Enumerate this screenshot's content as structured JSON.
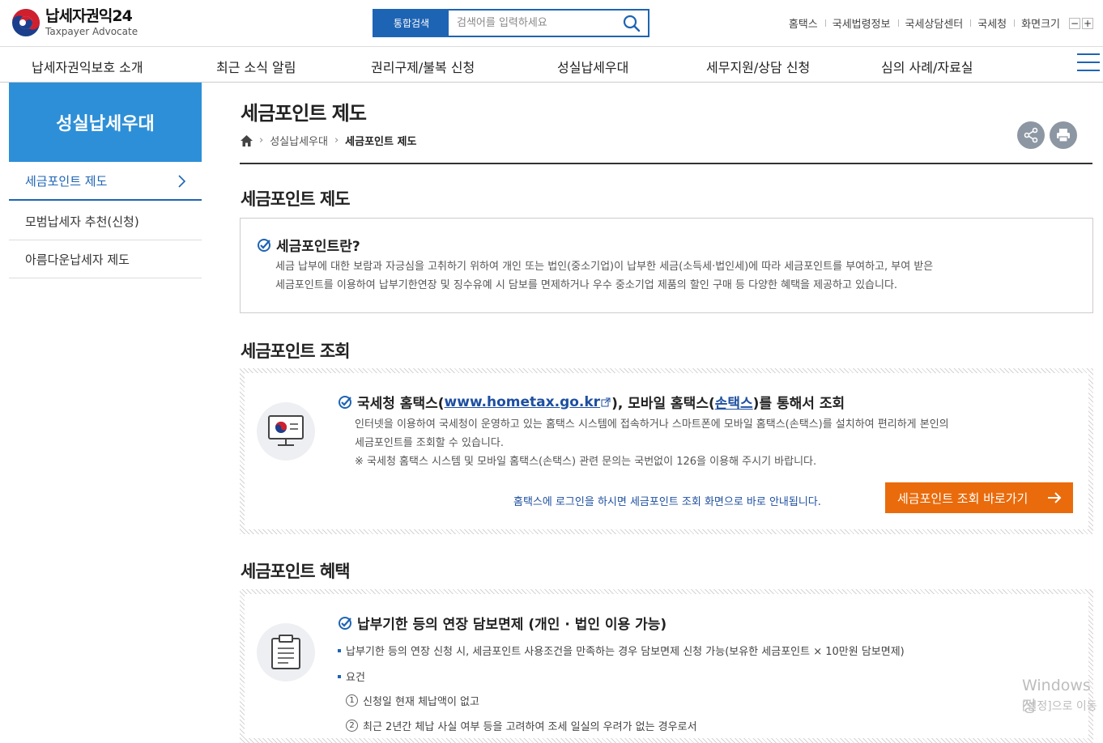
{
  "header": {
    "logo_title": "납세자권익24",
    "logo_sub": "Taxpayer Advocate",
    "search_tab": "통합검색",
    "search_placeholder": "검색어를 입력하세요",
    "util_links": [
      "홈택스",
      "국세법령정보",
      "국세상담센터",
      "국세청",
      "화면크기"
    ],
    "zoom_out": "−",
    "zoom_in": "+"
  },
  "gnb": [
    "납세자권익보호 소개",
    "최근 소식 알림",
    "권리구제/불복 신청",
    "성실납세우대",
    "세무지원/상담 신청",
    "심의 사례/자료실"
  ],
  "lnb": {
    "title": "성실납세우대",
    "items": [
      "세금포인트 제도",
      "모범납세자 추천(신청)",
      "아름다운납세자 제도"
    ]
  },
  "page": {
    "title": "세금포인트 제도",
    "breadcrumb": [
      "성실납세우대",
      "세금포인트 제도"
    ]
  },
  "section1": {
    "title": "세금포인트 제도",
    "heading": "세금포인트란?",
    "line1": "세금 납부에 대한 보람과 자긍심을 고취하기 위하여 개인 또는 법인(중소기업)이 납부한 세금(소득세·법인세)에 따라 세금포인트를 부여하고, 부여 받은",
    "line2": "세금포인트를 이용하여 납부기한연장 및 징수유예 시 담보를 면제하거나 우수 중소기업 제품의 할인 구매 등 다양한 혜택을 제공하고 있습니다."
  },
  "section2": {
    "title": "세금포인트 조회",
    "heading_pre": "국세청 홈택스(",
    "heading_link": "www.hometax.go.kr",
    "heading_post": "), 모바일 홈택스(",
    "heading_link2": "손택스",
    "heading_end": ")를 통해서 조회",
    "line1": "인터넷을 이용하여 국세청이 운영하고 있는 홈택스 시스템에 접속하거나 스마트폰에 모바일 홈택스(손택스)를 설치하여 편리하게 본인의",
    "line2": "세금포인트를 조회할 수 있습니다.",
    "note": "※ 국세청 홈택스 시스템 및 모바일 홈택스(손택스) 관련 문의는 국번없이 126을 이용해 주시기 바랍니다.",
    "guide": "홈택스에 로그인을 하시면 세금포인트 조회 화면으로 바로 안내됩니다.",
    "button": "세금포인트 조회 바로가기"
  },
  "section3": {
    "title": "세금포인트 혜택",
    "heading": "납부기한 등의 연장 담보면제 (개인 · 법인 이용 가능)",
    "bullet1": "납부기한 등의 연장 신청 시, 세금포인트 사용조건을 만족하는 경우 담보면제 신청 가능(보유한 세금포인트 × 10만원 담보면제)",
    "bullet2": "요건",
    "req1_num": "1",
    "req1": "신청일 현재 체납액이 없고",
    "req2_num": "2",
    "req2": "최근 2년간 체납 사실 여부 등을 고려하여 조세 일실의 우려가 없는 경우로서"
  },
  "watermark": {
    "line1": "Windows 정",
    "line2": "[설정]으로 이동"
  },
  "colors": {
    "brand_blue": "#1e64b4",
    "lnb_blue": "#2d8fd7",
    "orange": "#ea6b0b"
  }
}
